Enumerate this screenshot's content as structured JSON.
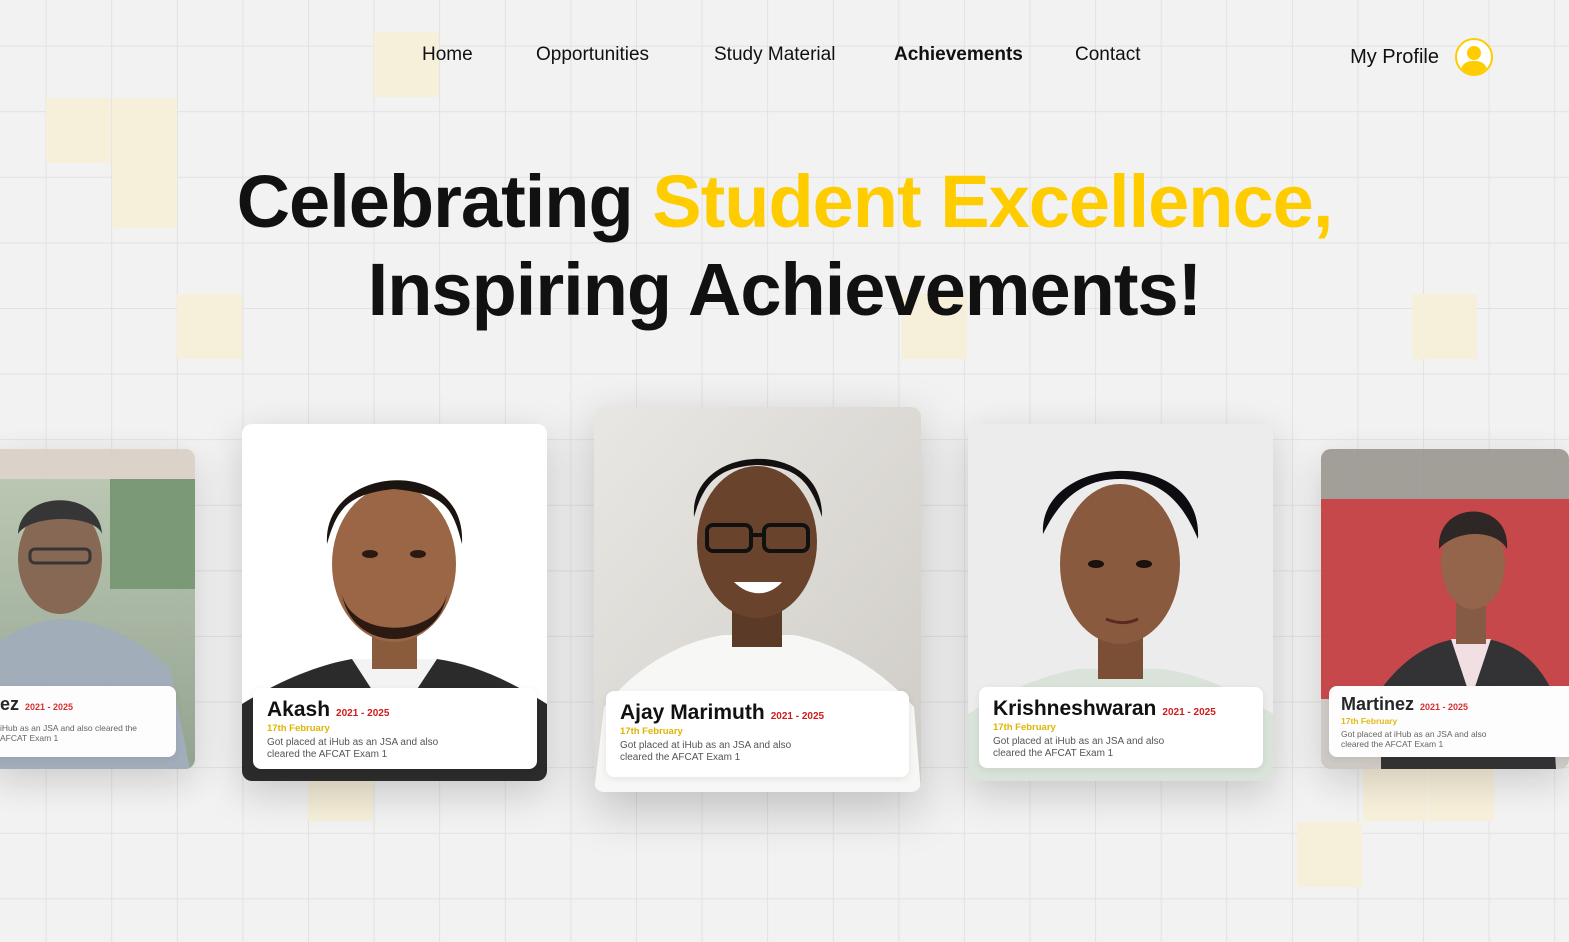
{
  "nav": {
    "items": [
      {
        "label": "Home"
      },
      {
        "label": "Opportunities"
      },
      {
        "label": "Study Material"
      },
      {
        "label": "Achievements"
      },
      {
        "label": "Contact"
      }
    ],
    "active": "Achievements",
    "profile_label": "My Profile"
  },
  "hero": {
    "line1_a": "Celebrating ",
    "line1_b": "Student Excellence,",
    "line2": "Inspiring Achievements!"
  },
  "cards": [
    {
      "name": "ez",
      "years": "2021 - 2025",
      "date": "",
      "desc": "iHub as an JSA and also cleared the AFCAT Exam 1"
    },
    {
      "name": "Akash",
      "years": "2021 - 2025",
      "date": "17th February",
      "desc": "Got placed at iHub as an JSA and also cleared the AFCAT Exam 1"
    },
    {
      "name": "Ajay Marimuth",
      "years": "2021 - 2025",
      "date": "17th February",
      "desc": "Got placed at iHub as an JSA and also cleared the AFCAT Exam 1"
    },
    {
      "name": "Krishneshwaran",
      "years": "2021 - 2025",
      "date": "17th February",
      "desc": "Got placed at iHub as an JSA and also cleared the AFCAT Exam 1"
    },
    {
      "name": "Martinez",
      "years": "2021 - 2025",
      "date": "17th February",
      "desc": "Got placed at iHub as an JSA and also cleared the AFCAT Exam 1"
    }
  ],
  "colors": {
    "accent": "#ffcc00",
    "years": "#d01c1c",
    "text": "#111111"
  }
}
